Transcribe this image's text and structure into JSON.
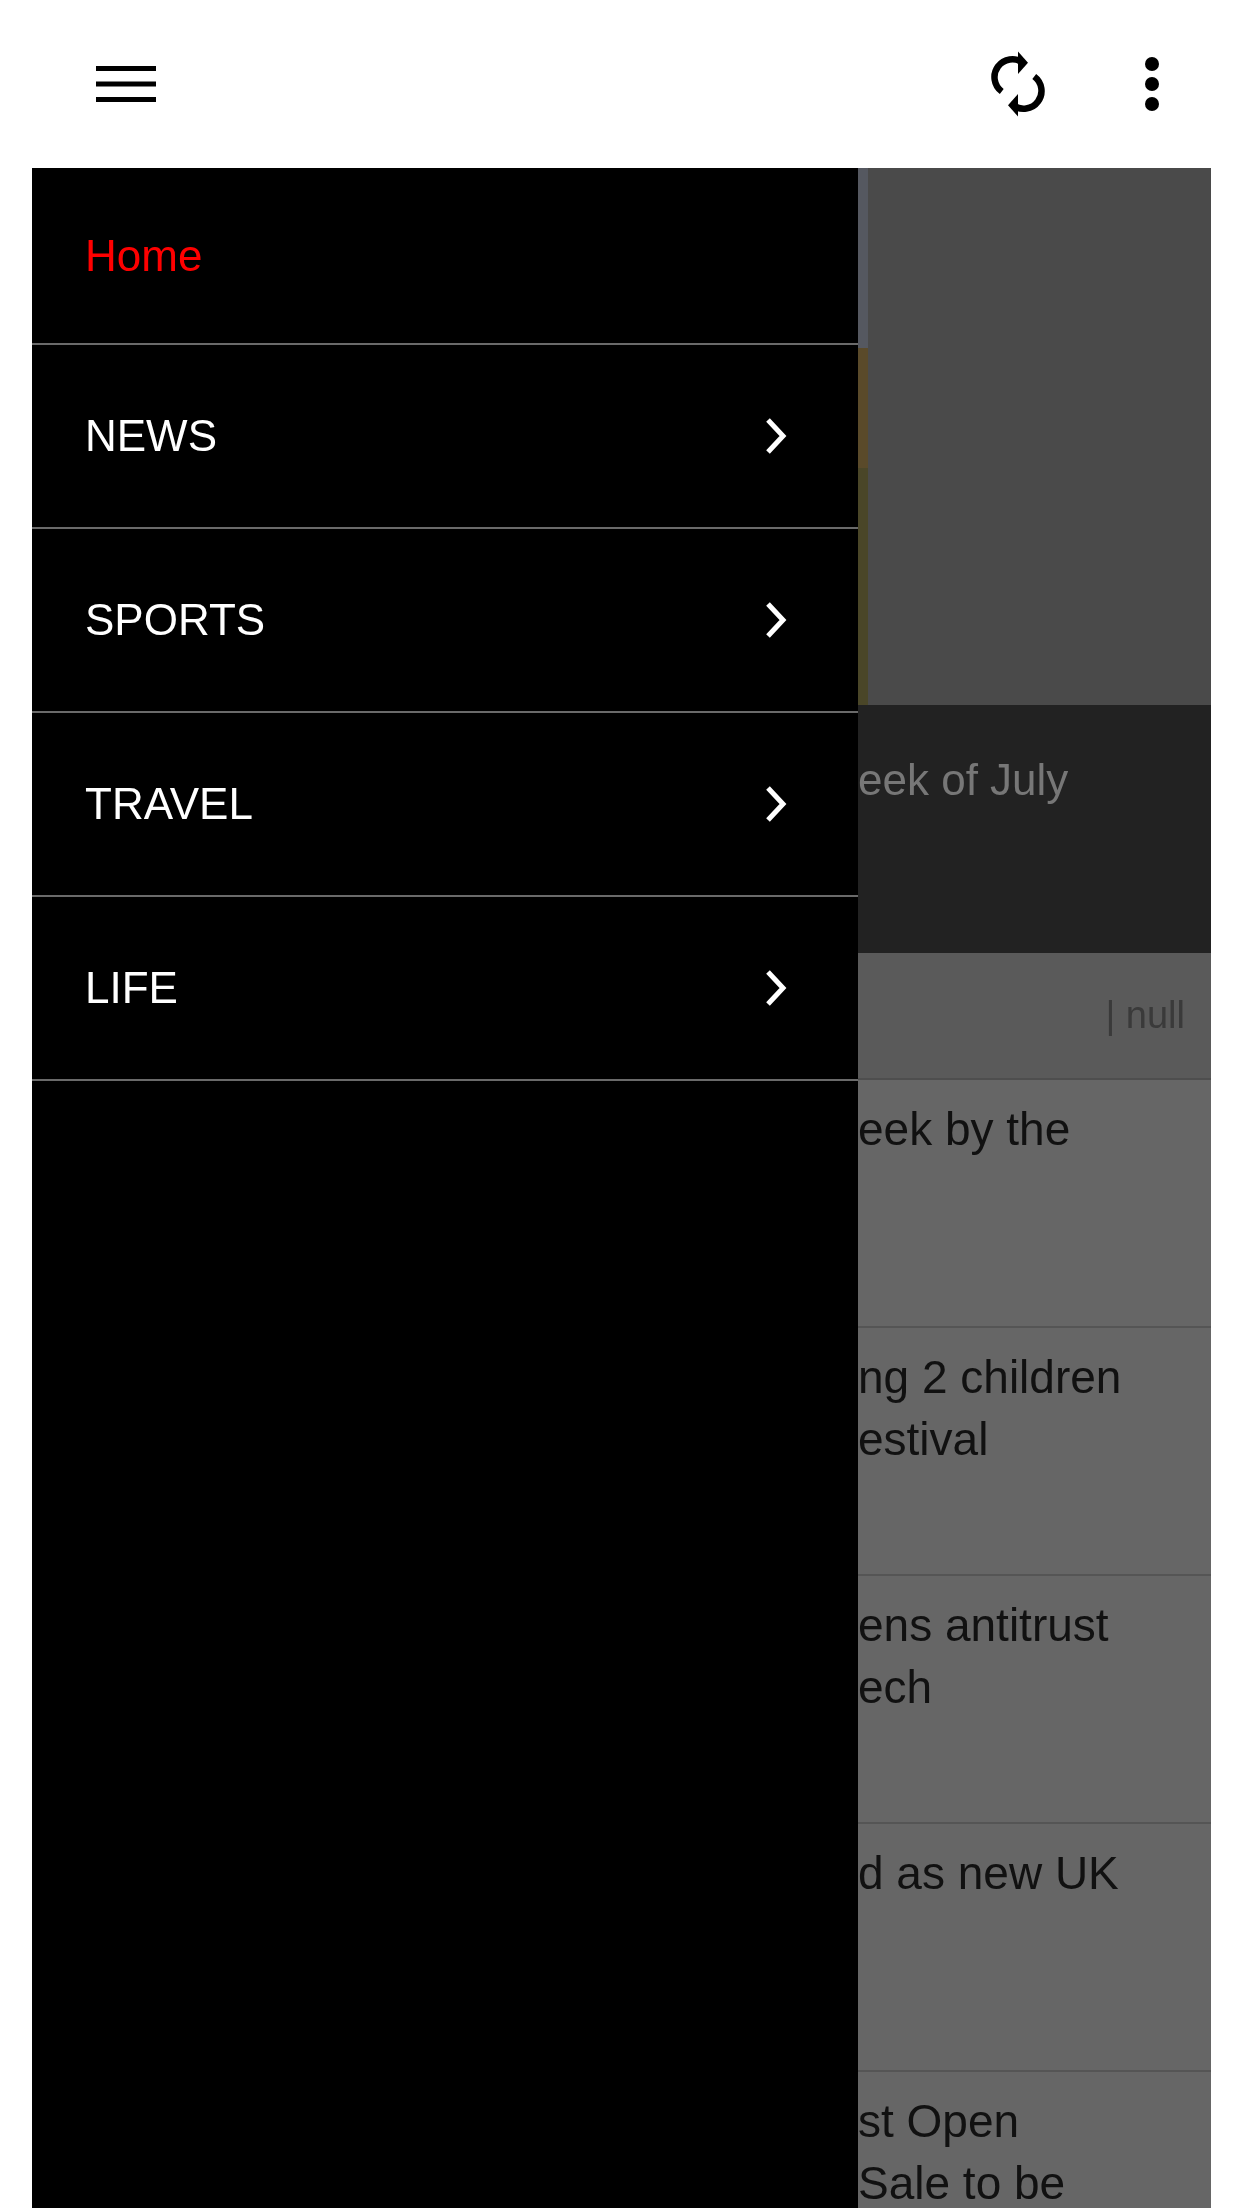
{
  "drawer": {
    "items": [
      {
        "label": "Home",
        "selected": true,
        "expandable": false
      },
      {
        "label": "NEWS",
        "selected": false,
        "expandable": true
      },
      {
        "label": "SPORTS",
        "selected": false,
        "expandable": true
      },
      {
        "label": "TRAVEL",
        "selected": false,
        "expandable": true
      },
      {
        "label": "LIFE",
        "selected": false,
        "expandable": true
      }
    ]
  },
  "content": {
    "featured": {
      "kind": "picture",
      "headline": "eek of July"
    },
    "meta": "| null",
    "stories": [
      {
        "headline": "eek by the"
      },
      {
        "headline": "ng 2 children\nestival"
      },
      {
        "headline": "ens antitrust\nech"
      },
      {
        "headline": "d as new UK"
      },
      {
        "headline": "st Open\nSale to be"
      }
    ]
  }
}
